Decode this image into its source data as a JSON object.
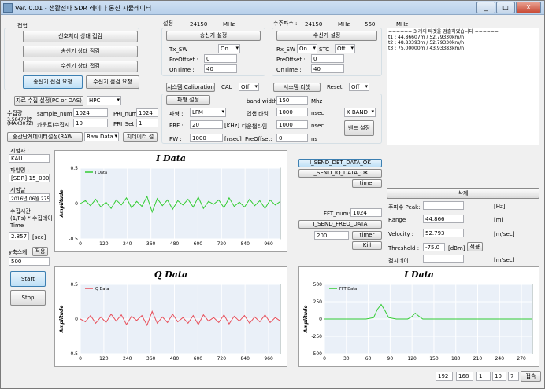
{
  "window": {
    "title": "Ver. 0.01 - 생활전파 SDR 레이다 통신 시뮬레이터",
    "minimize": "_",
    "maximize": "□",
    "close": "X"
  },
  "connect": {
    "group_label": "접업",
    "buttons": [
      "신호처리 상태 접검",
      "송신기 상태 점검",
      "수신기 상태 접검"
    ],
    "tx_check": "송신기 접검 요청",
    "rx_check": "수신기 점검 요청"
  },
  "collect": {
    "setting_button": "자료 수집 설정(PC or DAS)",
    "source": "HPC",
    "cycle_label": "수집량",
    "cycle_sub1": "3.5847기준",
    "cycle_sub2": "(MAX3072)",
    "sample_num_label": "sample_num :",
    "sample_num": "1024",
    "pri_num_label": "PRI_num",
    "pri_num": "1024",
    "counter_label": "카운트(수집시",
    "counter": "10",
    "pri_set_label": "PRI_Set :",
    "pri_set": "1",
    "stage_button": "중간단계데이터설정(RAW...",
    "stage_value": "Raw Data",
    "data_file_button": "지데이터 설"
  },
  "left_info": {
    "surveyor_label": "시험자 :",
    "surveyor": "KAU",
    "filename_label": "파일명 :",
    "filename": "[SDR]-15_0001",
    "date_label": "시험날",
    "date": "2016년 06월 275",
    "time_label": "수집시간",
    "time_sub1": "(1/Fs) * 수집데이",
    "time_sub2": "Time",
    "time_value": "2.857",
    "time_unit": "[sec]",
    "scale_label": "y축스케",
    "scale_button": "적용",
    "scale_value": "500",
    "start": "Start",
    "stop": "Stop"
  },
  "tx": {
    "freq_label": "설정",
    "freq": "24150",
    "freq_unit": "MHz",
    "setting_button": "송신기 설정",
    "sw_label": "Tx_SW",
    "sw": "On",
    "preoffset_label": "PreOffset :",
    "preoffset": "0",
    "ontime_label": "OnTime :",
    "ontime": "40"
  },
  "rx": {
    "freq_label": "수주파수 :",
    "freq": "24150",
    "freq_unit": "MHz",
    "freq2": "560",
    "freq2_unit": "MHz",
    "setting_button": "수신기 설정",
    "sw_label": "Rx_SW",
    "sw": "On",
    "stc_label": "STC",
    "stc": "Off",
    "preoffset_label": "PreOffset :",
    "preoffset": "0",
    "ontime_label": "OnTime :",
    "ontime": "40"
  },
  "system": {
    "calibration_button": "시스템 Calibration",
    "cal_label": "CAL",
    "cal": "Off",
    "reset_button": "시스템 리셋",
    "reset_label": "Reset",
    "reset": "Off",
    "waveform_button": "파형 설정",
    "bandwidth_label": "band width",
    "bandwidth": "150",
    "bandwidth_unit": "Mhz",
    "waveform_label": "파형 :",
    "waveform": "LFM",
    "up_label": "업챕 타임",
    "up": "1000",
    "up_unit": "nsec",
    "prf_label": "PRF :",
    "prf": "20",
    "prf_unit": "[KHz]",
    "down_label": "다운챕타임",
    "down": "1000",
    "down_unit": "nsec",
    "band_sel": "K BAND",
    "band_button": "밴드 설정",
    "pw_label": "PW :",
    "pw": "1000",
    "pw_unit": "[nsec]",
    "pre_label": "PreOffset:",
    "pre": "0",
    "pre_unit": "ns"
  },
  "log": {
    "lines": [
      "====== 3 개의 타겟을 검출하였습니다 ======",
      "t1 : 44.86607m / 52.79330km/h",
      "t2 : 48.83393m / 52.79330km/h",
      "t3 : 75.00000m / 43.93383km/h"
    ]
  },
  "commands": {
    "send_det": "I_SEND_DET_DATA_OK",
    "send_iq": "I_SEND_IQ_DATA_OK",
    "timer": "timer",
    "fft_num_label": "FFT_num:",
    "fft_num": "1024",
    "send_freq": "I_SEND_FREQ_DATA",
    "fft_timer_value": "200",
    "fft_timer": "timer",
    "kill": "Kill"
  },
  "detect": {
    "delete_button": "삭제",
    "peak_label": "주파수 Peak:",
    "peak_unit": "[Hz]",
    "range_label": "Range",
    "range": "44.866",
    "range_unit": "[m]",
    "velocity_label": "Velocity :",
    "velocity": "52.793",
    "velocity_unit": "[m/sec]",
    "threshold_label": "Threshold :",
    "threshold": "-75.0",
    "threshold_unit": "[dBm]",
    "threshold_apply": "적용",
    "detect_label": "검지데이",
    "detect_unit": "[m/sec]"
  },
  "ip": {
    "a": "192",
    "b": "168",
    "c": "1",
    "d": "10",
    "e": "7",
    "connect": "접속"
  },
  "chart_data": [
    {
      "type": "line",
      "title": "I Data",
      "legend": "I Data",
      "ylabel": "Amplitude",
      "color": "#33cc33",
      "ylim": [
        -0.5,
        0.5
      ],
      "yticks": [
        "0.5",
        "0",
        "-0.5"
      ],
      "xticks": [
        "0",
        "120",
        "240",
        "360",
        "480",
        "600",
        "720",
        "840",
        "960"
      ],
      "xlim": [
        0,
        1024
      ],
      "values": [
        0,
        0.04,
        -0.03,
        0.06,
        -0.05,
        0.02,
        -0.07,
        0.05,
        -0.02,
        0.08,
        -0.06,
        0.03,
        -0.04,
        0.1,
        -0.12,
        0.07,
        -0.03,
        0.05,
        -0.08,
        0.04,
        -0.02,
        0.06,
        -0.05,
        0.09,
        -0.07,
        0.03,
        -0.01,
        0.05,
        -0.06,
        0.08,
        -0.04,
        0.02,
        -0.05,
        0.06,
        -0.03,
        0.04,
        -0.07,
        0.05,
        -0.02,
        0.03
      ]
    },
    {
      "type": "line",
      "title": "Q Data",
      "legend": "Q Data",
      "ylabel": "Amplitude",
      "color": "#e8505b",
      "ylim": [
        -0.5,
        0.5
      ],
      "yticks": [
        "0.5",
        "0",
        "-0.5"
      ],
      "xticks": [
        "0",
        "120",
        "240",
        "360",
        "480",
        "600",
        "720",
        "840",
        "960"
      ],
      "xlim": [
        0,
        1024
      ],
      "values": [
        0,
        -0.04,
        0.05,
        -0.06,
        0.03,
        -0.05,
        0.07,
        -0.03,
        0.06,
        -0.08,
        0.04,
        -0.02,
        0.05,
        -0.09,
        0.11,
        -0.06,
        0.03,
        -0.05,
        0.07,
        -0.04,
        0.02,
        -0.06,
        0.05,
        -0.08,
        0.06,
        -0.03,
        0.02,
        -0.05,
        0.06,
        -0.07,
        0.04,
        -0.03,
        0.05,
        -0.06,
        0.03,
        -0.04,
        0.06,
        -0.05,
        0.02,
        -0.03
      ]
    },
    {
      "type": "line",
      "title": "I Data",
      "legend": "FFT Data",
      "ylabel": "Amplitude",
      "color": "#33cc33",
      "ylim": [
        -500,
        500
      ],
      "yticks": [
        "500",
        "250",
        "0",
        "-250",
        "-500"
      ],
      "xticks": [
        "0",
        "30",
        "60",
        "90",
        "120",
        "150",
        "180",
        "210",
        "240",
        "270"
      ],
      "xlim": [
        0,
        280
      ],
      "values": [
        0,
        0,
        0,
        0,
        0,
        0,
        0,
        0,
        0,
        0,
        0,
        0,
        10,
        20,
        140,
        210,
        120,
        20,
        10,
        0,
        0,
        0,
        0,
        30,
        85,
        40,
        0,
        0,
        0,
        0,
        0,
        0,
        0,
        0,
        0,
        0,
        0,
        0,
        0,
        0,
        0,
        0,
        0,
        0,
        0,
        0,
        0,
        0,
        0,
        0,
        0,
        0,
        0,
        0,
        0,
        0
      ]
    }
  ]
}
